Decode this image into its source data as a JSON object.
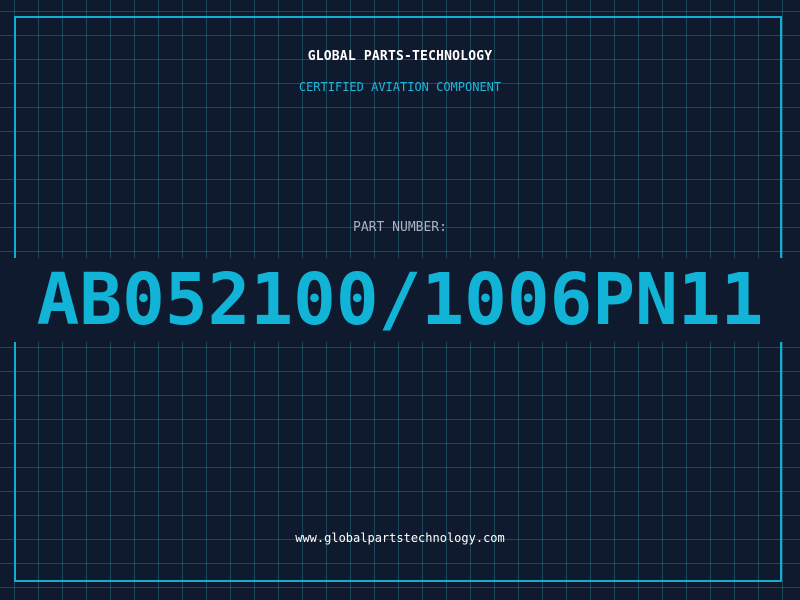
{
  "header": {
    "company": "GLOBAL PARTS-TECHNOLOGY",
    "subtitle": "CERTIFIED AVIATION COMPONENT"
  },
  "part": {
    "label": "PART NUMBER:",
    "number": "AB052100/1006PN11"
  },
  "footer": {
    "website": "www.globalpartstechnology.com"
  },
  "colors": {
    "background": "#101a2e",
    "grid": "#246e82",
    "accent": "#12aed0",
    "text_primary": "#ffffff",
    "text_muted": "#a9b3c2"
  }
}
